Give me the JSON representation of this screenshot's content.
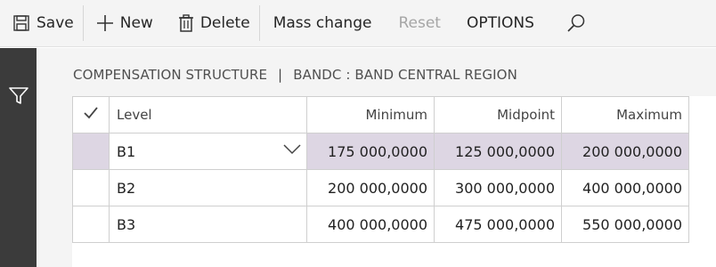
{
  "toolbar": {
    "save_label": "Save",
    "new_label": "New",
    "delete_label": "Delete",
    "mass_change_label": "Mass change",
    "reset_label": "Reset",
    "options_label": "OPTIONS"
  },
  "breadcrumb": {
    "part1": "COMPENSATION STRUCTURE",
    "separator": "|",
    "part2": "BANDC : BAND CENTRAL REGION"
  },
  "grid": {
    "columns": {
      "level": "Level",
      "minimum": "Minimum",
      "midpoint": "Midpoint",
      "maximum": "Maximum"
    },
    "rows": [
      {
        "level": "B1",
        "minimum": "175 000,0000",
        "midpoint": "125 000,0000",
        "maximum": "200 000,0000",
        "selected": true
      },
      {
        "level": "B2",
        "minimum": "200 000,0000",
        "midpoint": "300 000,0000",
        "maximum": "400 000,0000",
        "selected": false
      },
      {
        "level": "B3",
        "minimum": "400 000,0000",
        "midpoint": "475 000,0000",
        "maximum": "550 000,0000",
        "selected": false
      }
    ]
  },
  "icons": {
    "save": "save-icon",
    "new": "plus-icon",
    "delete": "trash-icon",
    "search": "search-icon",
    "filter": "filter-icon",
    "check": "checkmark-icon",
    "dropdown": "chevron-down-icon"
  },
  "colors": {
    "selected_row": "#ddd6e3",
    "rail": "#3b3b3b",
    "toolbar": "#f4f4f4",
    "disabled_text": "#a6a6a6"
  }
}
